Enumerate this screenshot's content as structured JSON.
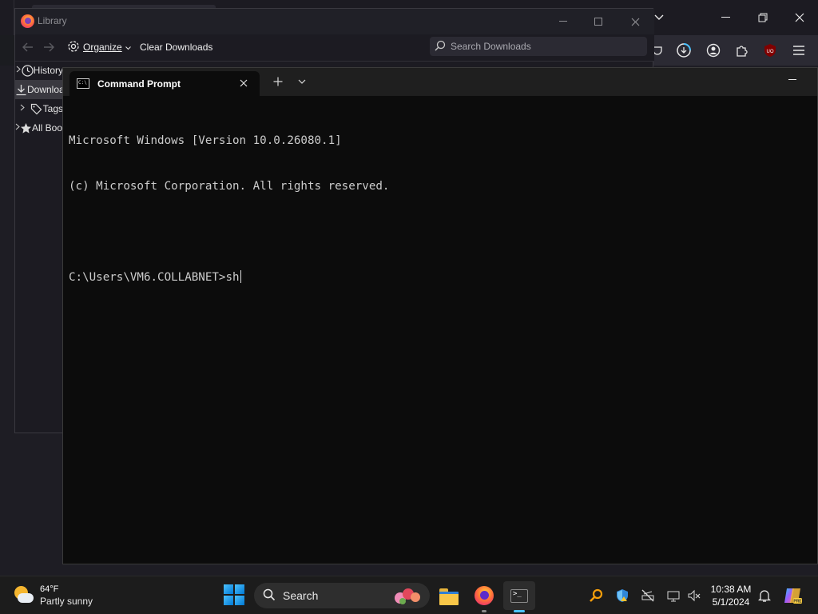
{
  "library": {
    "title": "Library",
    "toolbar": {
      "organize_label": "Organize",
      "clear_downloads_label": "Clear Downloads",
      "search_placeholder": "Search Downloads"
    },
    "tree": [
      {
        "label": "History",
        "icon": "clock-icon"
      },
      {
        "label": "Downloads",
        "icon": "download-icon",
        "selected": true
      },
      {
        "label": "Tags",
        "icon": "tag-icon"
      },
      {
        "label": "All Bookmarks",
        "icon": "star-icon"
      }
    ]
  },
  "terminal": {
    "tab_title": "Command Prompt",
    "lines": [
      "Microsoft Windows [Version 10.0.26080.1]",
      "(c) Microsoft Corporation. All rights reserved.",
      "",
      "C:\\Users\\VM6.COLLABNET>sh"
    ]
  },
  "taskbar": {
    "weather": {
      "temp": "64°F",
      "desc": "Partly sunny"
    },
    "search_label": "Search",
    "clock": {
      "time": "10:38 AM",
      "date": "5/1/2024"
    },
    "accent": "#4cc2ff"
  }
}
